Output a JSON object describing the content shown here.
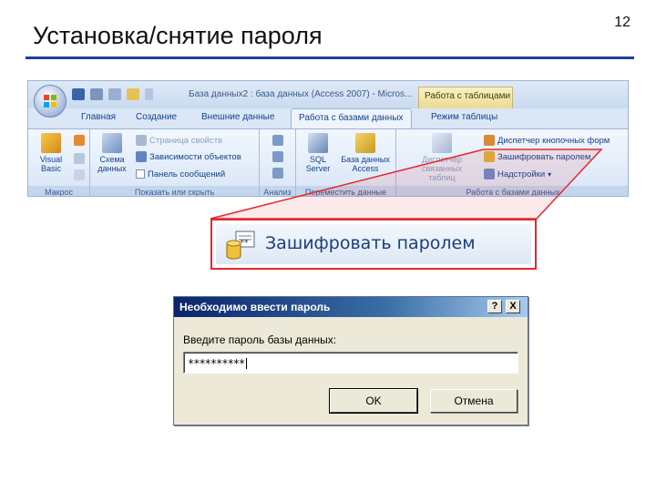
{
  "slide": {
    "title": "Установка/снятие пароля",
    "number": "12"
  },
  "ribbon": {
    "window_title": "База данных2 : база данных (Access 2007) - Micros...",
    "context_tab": "Работа с таблицами",
    "tabs": [
      "Главная",
      "Создание",
      "Внешние данные",
      "Работа с базами данных",
      "Режим таблицы"
    ],
    "active_tab_index": 3,
    "groups": {
      "macro": {
        "label": "Макрос",
        "visual_basic": "Visual Basic"
      },
      "show_hide": {
        "label": "Показать или скрыть",
        "schema": "Схема данных",
        "property_sheet": "Страница свойств",
        "object_dependencies": "Зависимости объектов",
        "message_bar": "Панель сообщений"
      },
      "analyze": {
        "label": "Анализ"
      },
      "move_data": {
        "label": "Переместить данные",
        "sql_server": "SQL Server",
        "access_db": "База данных Access"
      },
      "db_tools": {
        "label": "Работа с базами данных",
        "switchboard_manager": "Диспетчер кнопочных форм",
        "encrypt_password": "Зашифровать паролем",
        "addins": "Надстройки",
        "linked_table_manager": "Диспетчер связанных таблиц"
      }
    },
    "colors": {
      "accent_blue": "#15428b",
      "callout_red": "#e5282d",
      "title_rule": "#1f3f9a"
    }
  },
  "callout": {
    "label": "Зашифровать паролем"
  },
  "dialog": {
    "title": "Необходимо ввести пароль",
    "help_button": "?",
    "close_button": "X",
    "prompt": "Введите пароль базы данных:",
    "password_value": "**********",
    "ok_label": "OK",
    "cancel_label": "Отмена"
  }
}
